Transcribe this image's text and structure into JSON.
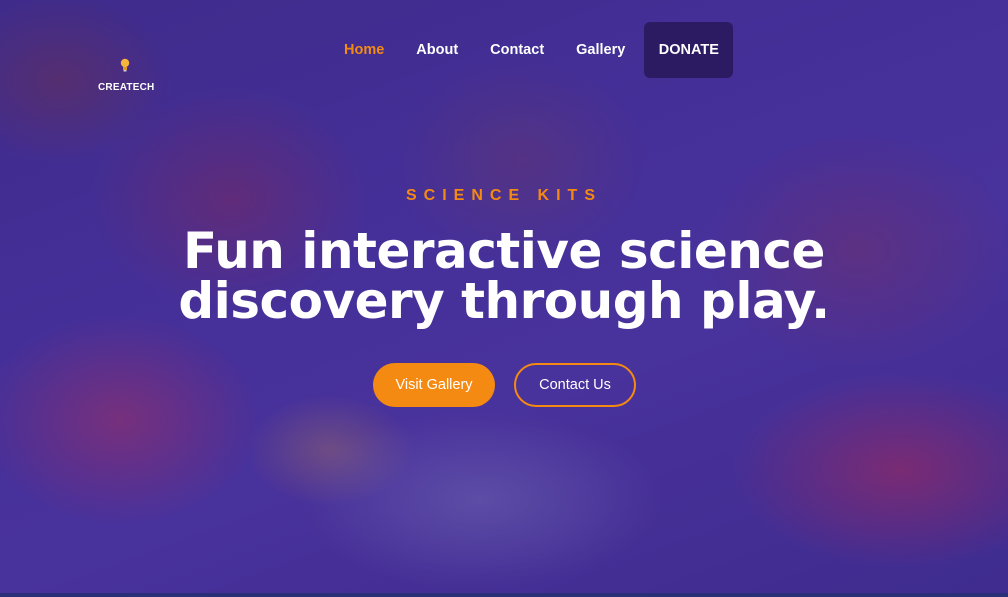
{
  "brand": {
    "name": "CREATECH",
    "icon": "lightbulb-icon",
    "icon_color": "#f5b43a"
  },
  "nav": {
    "items": [
      {
        "label": "Home",
        "active": true
      },
      {
        "label": "About",
        "active": false
      },
      {
        "label": "Contact",
        "active": false
      },
      {
        "label": "Gallery",
        "active": false
      }
    ],
    "donate_label": "DONATE"
  },
  "hero": {
    "eyebrow": "SCIENCE KITS",
    "headline_line1": "Fun interactive science",
    "headline_line2": "discovery through play.",
    "primary_button": "Visit Gallery",
    "secondary_button": "Contact Us"
  },
  "colors": {
    "accent": "#f58a12",
    "overlay": "#3e2c96",
    "donate_bg": "#2c1b63",
    "text": "#ffffff"
  }
}
